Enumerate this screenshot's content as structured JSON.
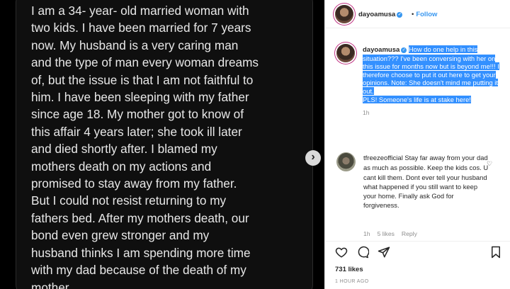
{
  "post": {
    "story_text": "I am  a 34- year- old married woman with\ntwo kids. I have been married for 7 years\nnow. My husband is a very caring man\nand the type of man every woman dreams\nof, but the issue is that I am not faithful to\nhim. I have been sleeping with my father\nsince age 18. My mother got to know of\nthis affair 4 years later; she took ill later\nand died shortly after. I blamed my\nmothers death on my actions and\npromised to stay away from my father.\nBut I could not resist returning to my\nfathers bed. After my mothers death, our\nbond even grew stronger and my\nhusband thinks I am spending more time\nwith my dad because of the death of my\nmother.",
    "next_arrow": "›"
  },
  "header": {
    "username": "dayoamusa",
    "verified_mark": "✓",
    "separator": "•",
    "follow_label": "Follow"
  },
  "caption": {
    "username": "dayoamusa",
    "verified_mark": "✓",
    "text": "How do one help in this situation??? I've been conversing with her on this issue for months now but is beyond me!!! I therefore choose to put it out here to get your opinions. Note: She doesn't mind me putting it out.",
    "text_2": "PLS! Someone's life is at stake here!",
    "age": "1h"
  },
  "comment": {
    "username": "tfreezeofficial",
    "text": "Stay far away from your dad as much as possible. Keep the kids cos. U cant kill them. Dont ever tell your husband what happened if you still want to keep your home. Finally ask God for forgiveness.",
    "age": "1h",
    "likes": "5 likes",
    "reply_label": "Reply",
    "heart": "♡"
  },
  "actions": {
    "icons": [
      "heart-icon",
      "comment-icon",
      "share-icon",
      "bookmark-icon"
    ]
  },
  "stats": {
    "likes": "731 likes",
    "posted": "1 HOUR AGO"
  },
  "colors": {
    "accent": "#3897f0",
    "highlight": "#3390ff",
    "muted": "#8e8e8e"
  }
}
